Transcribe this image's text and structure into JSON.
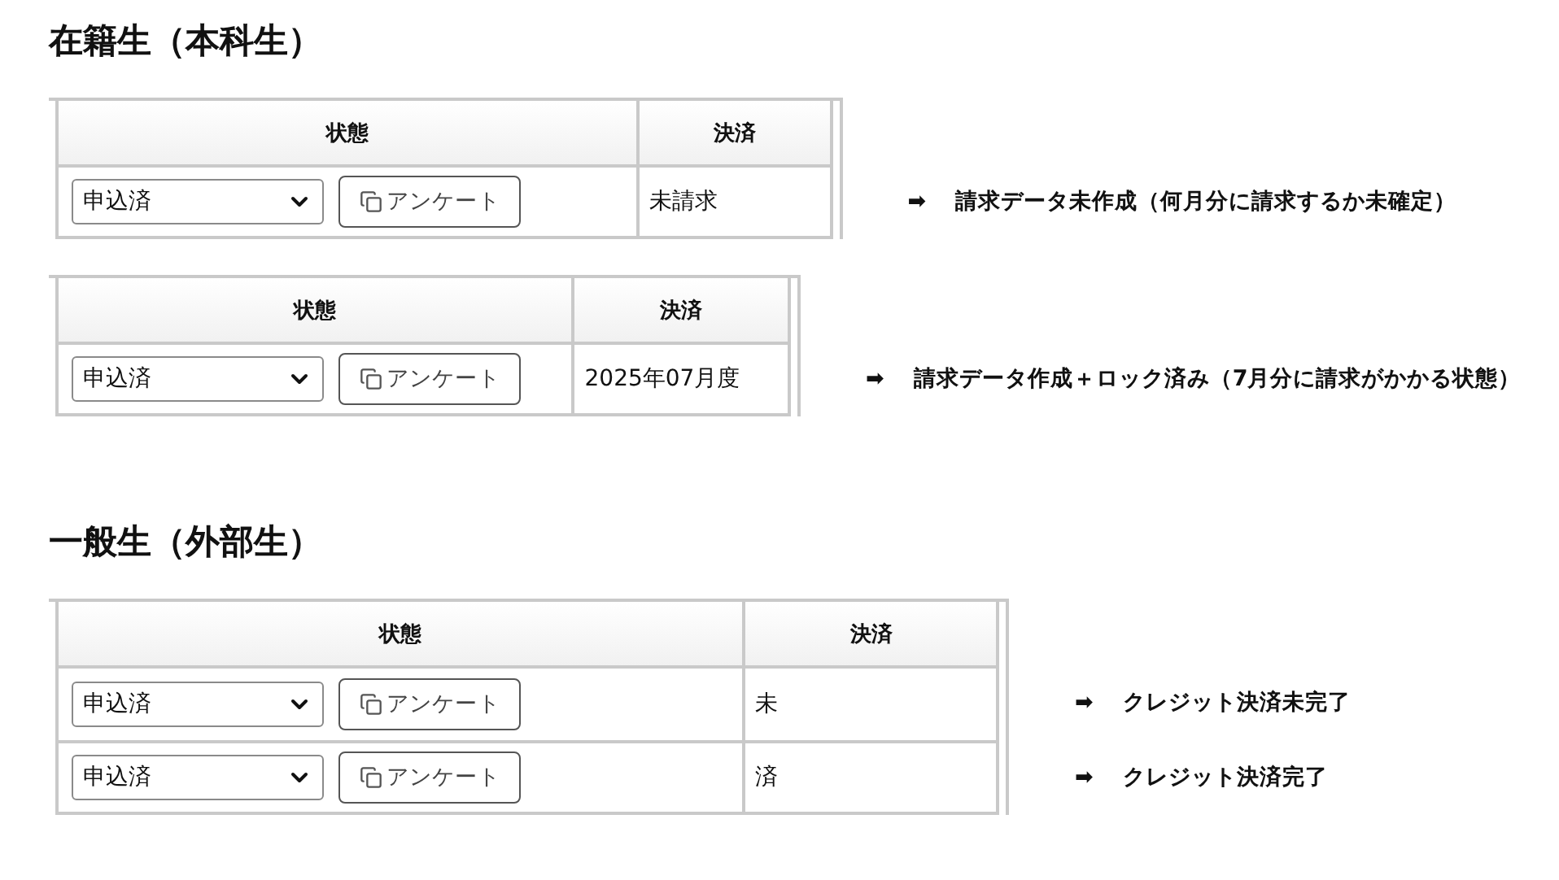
{
  "sections": [
    {
      "heading": "在籍生（本科生）",
      "tables": [
        {
          "columns": [
            "状態",
            "決済"
          ],
          "rows": [
            {
              "status": "申込済",
              "button": "アンケート",
              "payment": "未請求",
              "note": {
                "arrow": "➡",
                "text": "請求データ未作成（何月分に請求するか未確定）"
              }
            }
          ]
        },
        {
          "columns": [
            "状態",
            "決済"
          ],
          "rows": [
            {
              "status": "申込済",
              "button": "アンケート",
              "payment": "2025年07月度",
              "note": {
                "arrow": "➡",
                "text": "請求データ作成＋ロック済み（7月分に請求がかかる状態）"
              }
            }
          ]
        }
      ]
    },
    {
      "heading": "一般生（外部生）",
      "tables": [
        {
          "columns": [
            "状態",
            "決済"
          ],
          "rows": [
            {
              "status": "申込済",
              "button": "アンケート",
              "payment": "未",
              "note": {
                "arrow": "➡",
                "text": "クレジット決済未完了"
              }
            },
            {
              "status": "申込済",
              "button": "アンケート",
              "payment": "済",
              "note": {
                "arrow": "➡",
                "text": "クレジット決済完了"
              }
            }
          ]
        }
      ]
    }
  ]
}
